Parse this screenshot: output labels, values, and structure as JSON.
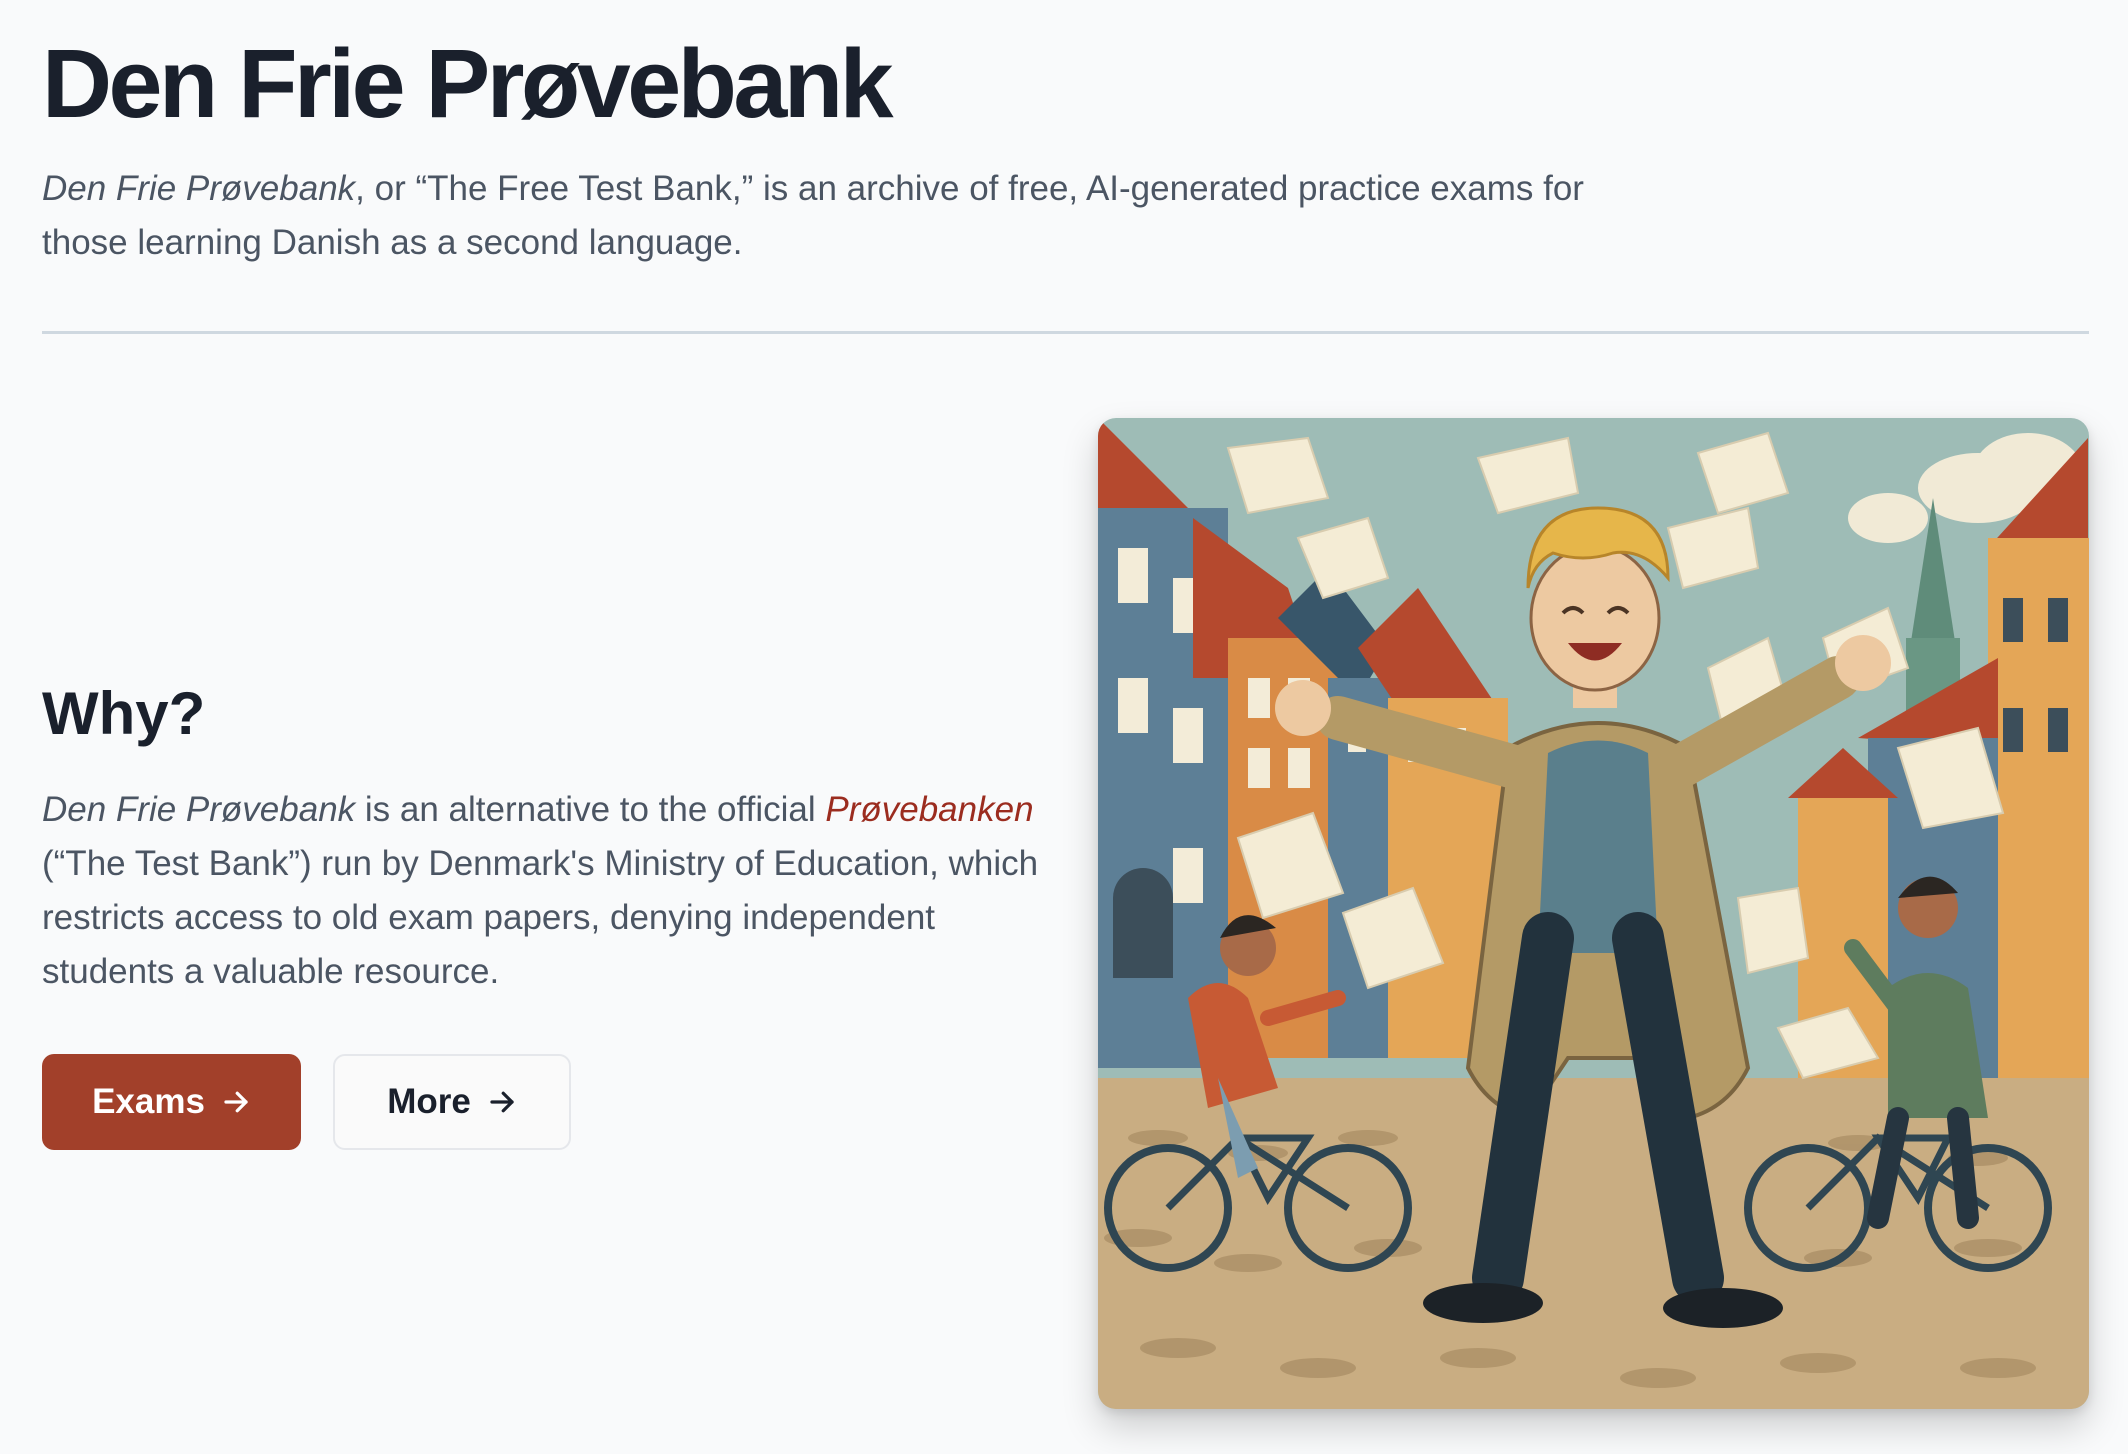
{
  "header": {
    "title": "Den Frie Prøvebank",
    "intro_italic": "Den Frie Prøvebank",
    "intro_rest": ", or “The Free Test Bank,” is an archive of free, AI-generated practice exams for those learning Danish as a second language."
  },
  "why": {
    "heading": "Why?",
    "body_italic": "Den Frie Prøvebank",
    "body_part1": " is an alternative to the official ",
    "link_label": "Prøvebanken",
    "body_part2": " (“The Test Bank”) run by Denmark's Ministry of Education, which restricts access to old exam papers, denying independent students a valuable resource."
  },
  "buttons": {
    "exams_label": "Exams",
    "more_label": "More",
    "arrow_icon": "arrow-right-icon"
  },
  "hero_image": {
    "icon": "illustration-happy-man-papers-bicycles"
  },
  "colors": {
    "brand": "#a2402a",
    "link": "#9b2c1f",
    "text": "#1a202c",
    "muted": "#4b5563",
    "background": "#f9fafb",
    "divider": "#cfd8e0"
  }
}
